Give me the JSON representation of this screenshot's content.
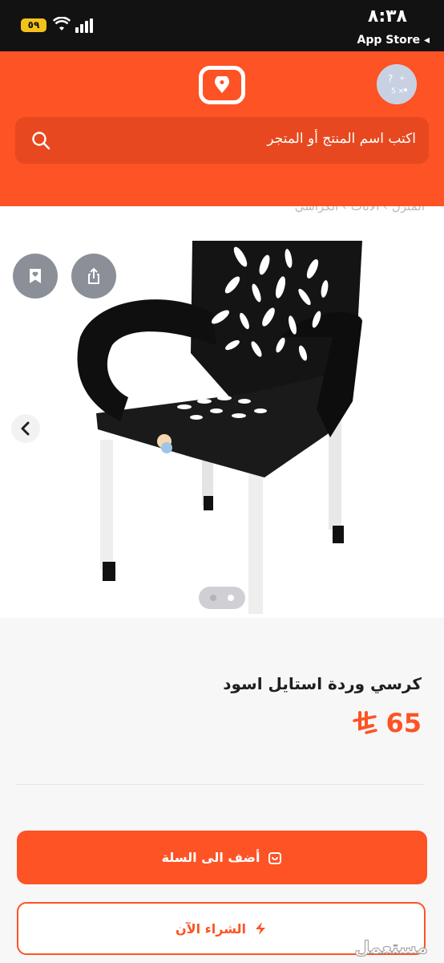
{
  "status_bar": {
    "time": "٨:٣٨",
    "battery": "٥٩",
    "back_app": "App Store ◂"
  },
  "header": {
    "logo_icon": "store-pin-logo",
    "avatar_icon": "avatar"
  },
  "search": {
    "placeholder": "اكتب اسم المنتج أو المتجر",
    "icon": "search-icon"
  },
  "breadcrumb_partial": "المنزل › الأثاث › الكراسي",
  "gallery": {
    "image_count": 2,
    "active_index": 2
  },
  "product": {
    "title": "كرسي وردة استايل اسود",
    "price": "65",
    "currency_icon": "riyal-symbol"
  },
  "actions": {
    "add_to_cart": "أضف الى السلة",
    "buy_now": "الشراء الآن"
  },
  "watermark": "مستعمل",
  "colors": {
    "brand": "#fd5325",
    "background": "#f7f7f7"
  }
}
